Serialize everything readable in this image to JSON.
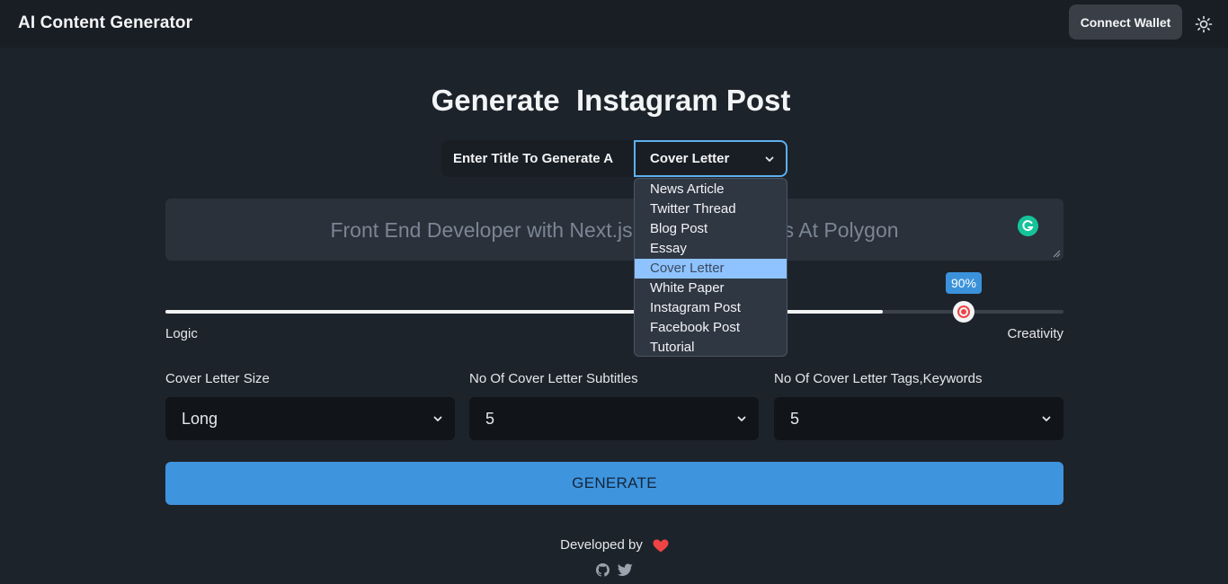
{
  "app": {
    "title": "AI Content Generator",
    "connect_wallet_label": "Connect Wallet",
    "theme_icon": "sun-icon"
  },
  "main": {
    "heading": "Generate  Instagram Post",
    "title_prompt_label": "Enter Title To Generate A",
    "content_type_selected": "Cover Letter",
    "content_type_options": [
      "News Article",
      "Twitter Thread",
      "Blog Post",
      "Essay",
      "Cover Letter",
      "White Paper",
      "Instagram Post",
      "Facebook Post",
      "Tutorial"
    ],
    "title_input_value": "Front End Developer with Next.js",
    "title_input_value_tail": "s At Polygon",
    "grammarly_icon": "grammarly-icon"
  },
  "slider": {
    "value_label": "90%",
    "value": 0.9,
    "min_label": "Logic",
    "max_label": "Creativity"
  },
  "options": {
    "size_label": "Cover Letter Size",
    "size_value": "Long",
    "subtitles_label": "No Of Cover Letter Subtitles",
    "subtitles_value": "5",
    "tags_label": "No Of Cover Letter Tags,Keywords",
    "tags_value": "5"
  },
  "generate_label": "GENERATE",
  "footer": {
    "developed_by": "Developed by",
    "heart_icon": "heart-icon",
    "github_icon": "github-icon",
    "twitter_icon": "twitter-icon"
  },
  "colors": {
    "accent": "#3f94de",
    "background": "#1d232a",
    "heart": "#ef4444"
  }
}
